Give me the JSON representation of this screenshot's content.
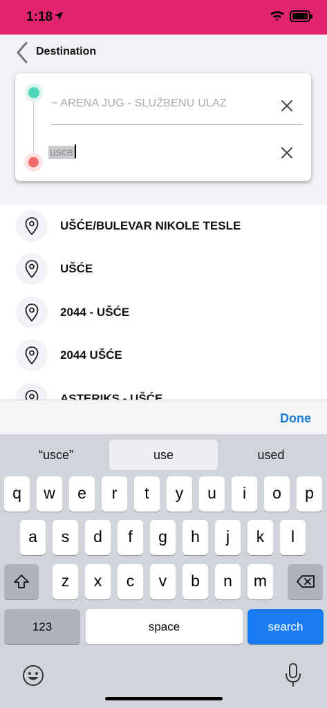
{
  "status_bar": {
    "time": "1:18"
  },
  "nav": {
    "title": "Destination"
  },
  "route": {
    "origin_value": "~ ARENA JUG - SLUŽBENU ULAZ",
    "destination_value": "usce"
  },
  "results": [
    {
      "label": "UŠĆE/BULEVAR NIKOLE TESLE"
    },
    {
      "label": "UŠĆE"
    },
    {
      "label": "2044 - UŠĆE"
    },
    {
      "label": "2044 UŠĆE"
    },
    {
      "label": "ASTERIKS - UŠĆE"
    }
  ],
  "keyboard": {
    "done_label": "Done",
    "suggestions": [
      "“usce”",
      "use",
      "used"
    ],
    "row1": [
      "q",
      "w",
      "e",
      "r",
      "t",
      "y",
      "u",
      "i",
      "o",
      "p"
    ],
    "row2": [
      "a",
      "s",
      "d",
      "f",
      "g",
      "h",
      "j",
      "k",
      "l"
    ],
    "row3": [
      "z",
      "x",
      "c",
      "v",
      "b",
      "n",
      "m"
    ],
    "numbers_label": "123",
    "space_label": "space",
    "search_label": "search",
    "search_color": "#1a7cf5"
  },
  "colors": {
    "status_bar": "#e0246f",
    "origin_dot": "#4fd6b6",
    "destination_dot": "#f06b6b",
    "accent": "#1c7bd9"
  }
}
